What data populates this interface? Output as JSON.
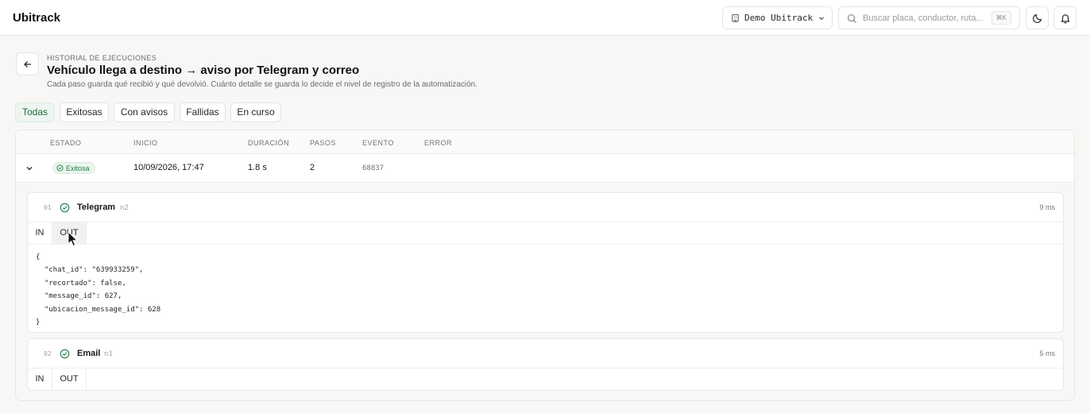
{
  "app": {
    "brand": "Ubitrack",
    "org_name": "Demo Ubitrack",
    "search_placeholder": "Buscar placa, conductor, ruta...",
    "search_shortcut": "⌘K"
  },
  "page": {
    "eyebrow": "HISTORIAL DE EJECUCIONES",
    "title": "Vehículo llega a destino → aviso por Telegram y correo",
    "subtitle": "Cada paso guarda qué recibió y qué devolvió. Cuánto detalle se guarda lo decide el nivel de registro de la automatización."
  },
  "filters": [
    {
      "label": "Todas",
      "active": true
    },
    {
      "label": "Exitosas",
      "active": false
    },
    {
      "label": "Con avisos",
      "active": false
    },
    {
      "label": "Fallidas",
      "active": false
    },
    {
      "label": "En curso",
      "active": false
    }
  ],
  "table": {
    "headers": {
      "estado": "ESTADO",
      "inicio": "INICIO",
      "duracion": "DURACIÓN",
      "pasos": "PASOS",
      "evento": "EVENTO",
      "error": "ERROR"
    },
    "rows": [
      {
        "estado": "Exitosa",
        "inicio": "10/09/2026, 17:47",
        "duracion": "1.8 s",
        "pasos": "2",
        "evento": "68837",
        "error": ""
      }
    ]
  },
  "steps": [
    {
      "index": "01",
      "name": "Telegram",
      "node": "n2",
      "duration": "9 ms",
      "tab_in": "IN",
      "tab_out": "OUT",
      "active_tab": "OUT",
      "output_lines": [
        "{",
        "  \"chat_id\": \"639933259\",",
        "  \"recortado\": false,",
        "  \"message_id\": 627,",
        "  \"ubicacion_message_id\": 628",
        "}"
      ]
    },
    {
      "index": "02",
      "name": "Email",
      "node": "n1",
      "duration": "5 ms",
      "tab_in": "IN",
      "tab_out": "OUT"
    }
  ],
  "colors": {
    "success": "#1f7a44",
    "accent_bg": "#eef5f0"
  }
}
